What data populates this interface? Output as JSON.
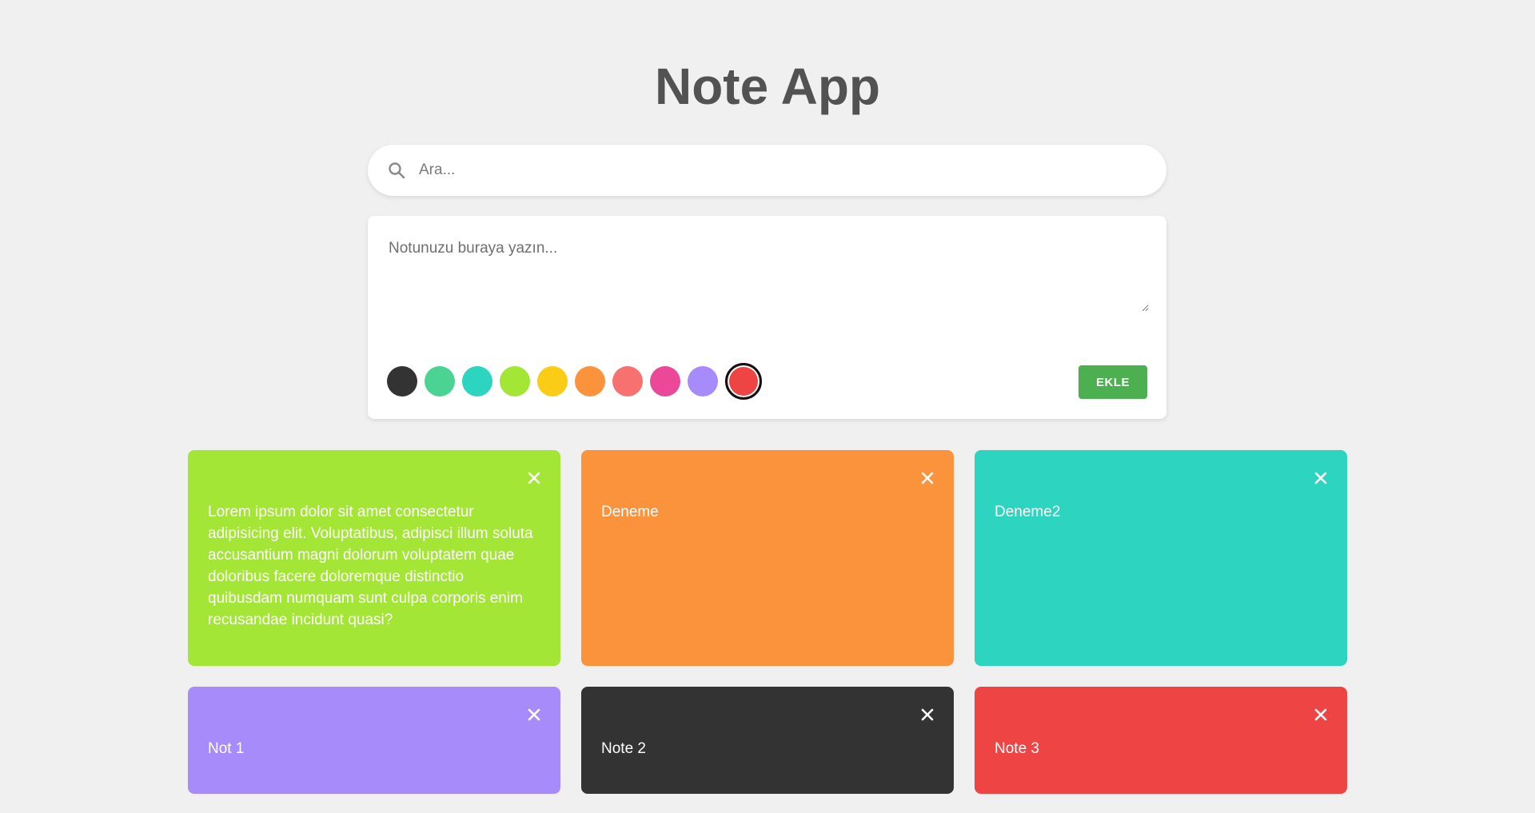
{
  "app": {
    "title": "Note App"
  },
  "search": {
    "placeholder": "Ara...",
    "icon": "search-icon"
  },
  "composer": {
    "placeholder": "Notunuzu buraya yazın...",
    "add_label": "EKLE",
    "add_color": "#4caf50",
    "colors": [
      "#333333",
      "#4ad393",
      "#2dd4bf",
      "#a3e635",
      "#facc15",
      "#fb923c",
      "#f87171",
      "#ec4899",
      "#a78bfa",
      "#ef4444"
    ],
    "selected_color": "#ef4444"
  },
  "notes": [
    {
      "text": "Lorem ipsum dolor sit amet consectetur adipisicing elit. Voluptatibus, adipisci illum soluta accusantium magni dolorum voluptatem quae doloribus facere doloremque distinctio quibusdam numquam sunt culpa corporis enim recusandae incidunt quasi?",
      "color": "#a3e635"
    },
    {
      "text": "Deneme",
      "color": "#fb923c"
    },
    {
      "text": "Deneme2",
      "color": "#2dd4bf"
    },
    {
      "text": "Not 1",
      "color": "#a78bfa"
    },
    {
      "text": "Note 2",
      "color": "#333333"
    },
    {
      "text": "Note 3",
      "color": "#ef4444"
    }
  ]
}
